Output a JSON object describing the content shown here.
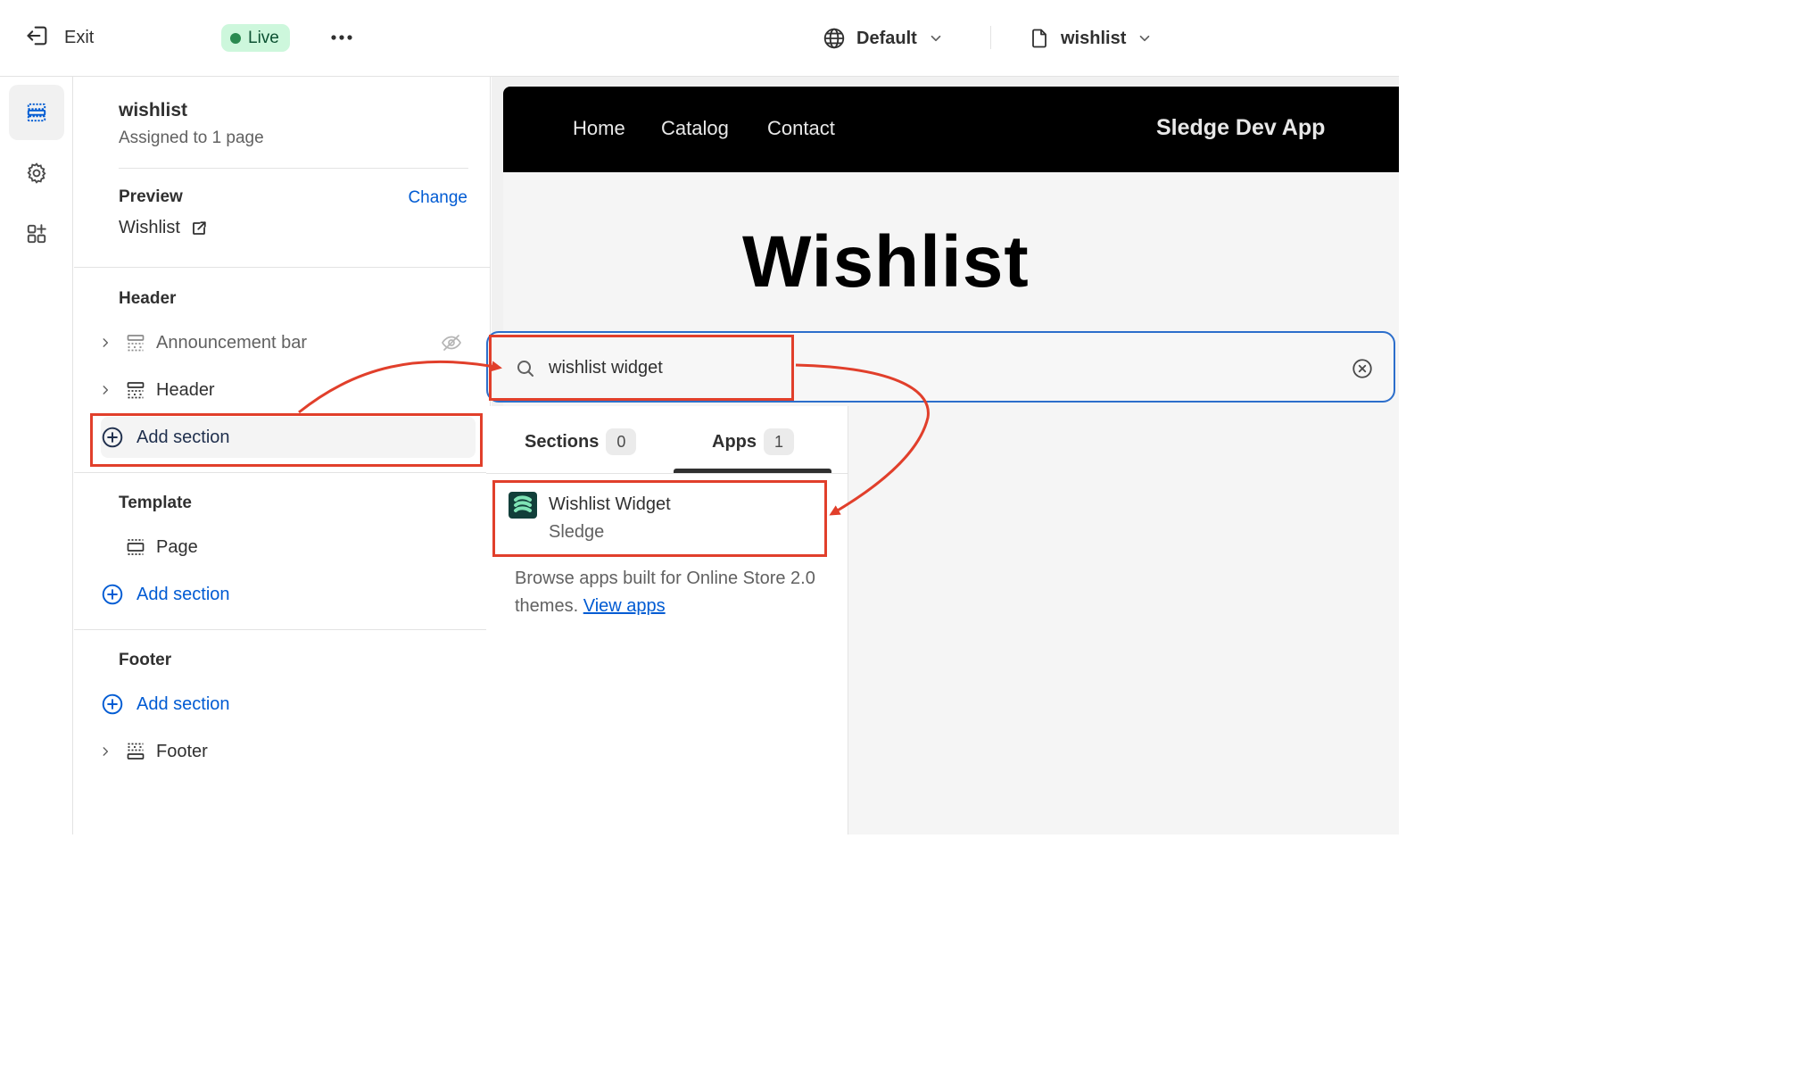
{
  "topbar": {
    "exit_label": "Exit",
    "live_label": "Live",
    "theme_select": "Default",
    "template_select": "wishlist"
  },
  "sidebar": {
    "page_name": "wishlist",
    "page_sub": "Assigned to 1 page",
    "preview_title": "Preview",
    "change_label": "Change",
    "preview_value": "Wishlist",
    "header_group": {
      "title": "Header",
      "items": [
        "Announcement bar",
        "Header"
      ],
      "add_label": "Add section"
    },
    "template_group": {
      "title": "Template",
      "items": [
        "Page"
      ],
      "add_label": "Add section"
    },
    "footer_group": {
      "title": "Footer",
      "add_label": "Add section",
      "items": [
        "Footer"
      ]
    }
  },
  "store": {
    "nav": [
      "Home",
      "Catalog",
      "Contact"
    ],
    "brand": "Sledge Dev App",
    "heading": "Wishlist"
  },
  "search": {
    "value": "wishlist widget",
    "tabs": [
      {
        "label": "Sections",
        "count": "0"
      },
      {
        "label": "Apps",
        "count": "1"
      }
    ],
    "result": {
      "name": "Wishlist Widget",
      "vendor": "Sledge"
    },
    "browse_text": "Browse apps built for Online Store 2.0 themes.",
    "browse_link": "View apps"
  },
  "colors": {
    "accent": "#005bd3",
    "annotation": "#e13f2b",
    "live_bg": "#cdf7dc"
  }
}
